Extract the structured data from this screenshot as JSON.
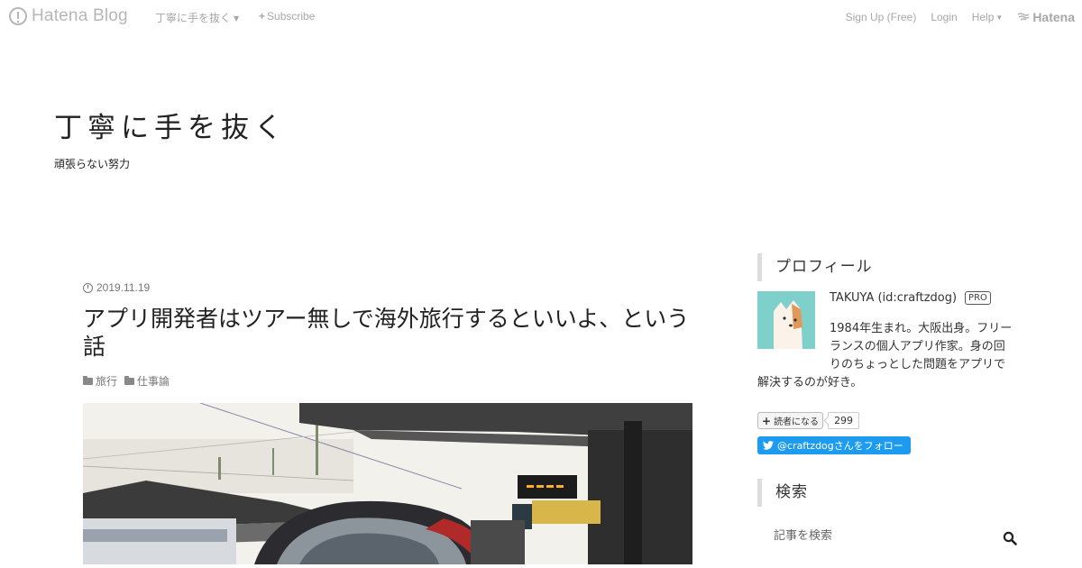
{
  "navbar": {
    "logo_text": "Hatena Blog",
    "blog_menu_label": "丁寧に手を抜く",
    "subscribe_label": "Subscribe",
    "signup_label": "Sign Up (Free)",
    "login_label": "Login",
    "help_label": "Help",
    "hatena_label": "Hatena"
  },
  "header": {
    "title": "丁寧に手を抜く",
    "description": "頑張らない努力"
  },
  "article": {
    "date": "2019.11.19",
    "title": "アプリ開発者はツアー無しで海外旅行するといいよ、という話",
    "categories": [
      "旅行",
      "仕事論"
    ]
  },
  "sidebar": {
    "profile": {
      "heading": "プロフィール",
      "name": "TAKUYA (id:craftzdog)",
      "badge": "PRO",
      "desc_line1": "1984年生まれ。大阪出身。フリー",
      "desc_line2": "ランスの個人アプリ作家。身の回",
      "desc_line3": "りのちょっとした問題をアプリで",
      "desc_line4": "解決するのが好き。",
      "reader_button": "読者になる",
      "reader_count": "299",
      "twitter_follow": "@craftzdogさんをフォロー"
    },
    "search": {
      "heading": "検索",
      "placeholder": "記事を検索"
    }
  },
  "colors": {
    "twitter_blue": "#1d9bf0",
    "avatar_bg": "#7fcfcb",
    "nav_text": "#a7a7a7"
  }
}
